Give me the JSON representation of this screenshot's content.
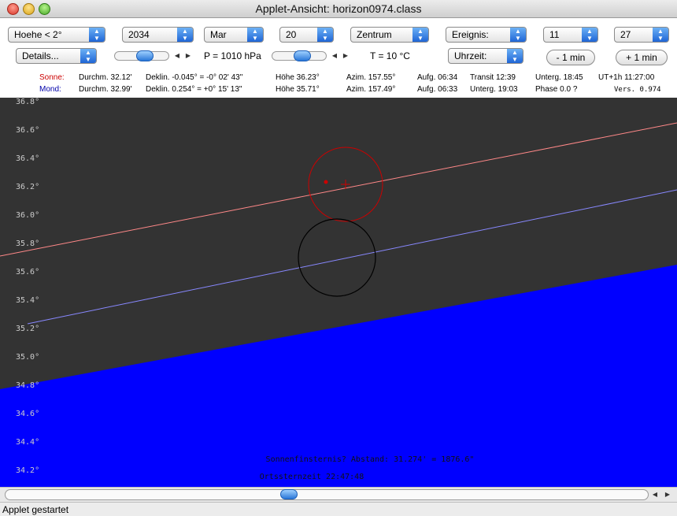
{
  "window": {
    "title": "Applet-Ansicht: horizon0974.class"
  },
  "controls": {
    "height_select": "Hoehe < 2°",
    "year_select": "2034",
    "month_select": "Mar",
    "day_select": "20",
    "center_select": "Zentrum",
    "event_select": "Ereignis:",
    "hour_select": "11",
    "minute_select": "27",
    "details_select": "Details...",
    "pressure_label": "P = 1010 hPa",
    "temp_label": "T = 10 °C",
    "time_select": "Uhrzeit:",
    "minus_min": "- 1 min",
    "plus_min": "+ 1 min"
  },
  "sun": {
    "name": "Sonne:",
    "diameter": "Durchm. 32.12'",
    "declination": "Deklin. -0.045° = -0° 02' 43\"",
    "altitude": "Höhe 36.23°",
    "azimuth": "Azim. 157.55°",
    "rise": "Aufg. 06:34",
    "transit": "Transit 12:39",
    "set": "Unterg. 18:45",
    "ut": "UT+1h  11:27:00"
  },
  "moon": {
    "name": "Mond:",
    "diameter": "Durchm. 32.99'",
    "declination": "Deklin. 0.254° = +0° 15' 13\"",
    "altitude": "Höhe 35.71°",
    "azimuth": "Azim. 157.49°",
    "rise": "Aufg. 06:33",
    "set": "Unterg. 19:03",
    "phase": "Phase 0.0 ?",
    "version": "Vers. 0.974"
  },
  "chart_data": {
    "type": "scatter",
    "y_axis_ticks": [
      "36.8°",
      "36.6°",
      "36.4°",
      "36.2°",
      "36.0°",
      "35.8°",
      "35.6°",
      "35.4°",
      "35.2°",
      "35.0°",
      "34.8°",
      "34.6°",
      "34.4°",
      "34.2°"
    ],
    "sky_color": "#333333",
    "ground_color": "#0000ff",
    "sun_color": "#cc0000",
    "sun_path_color": "#ff8888",
    "moon_path_color": "#8888ff",
    "moon_color": "#000000",
    "eclipse_note": "Sonnenfinsternis? Abstand: 31.274' = 1876.6\"",
    "sidereal_time": "Ortssternzeit 22:47:48"
  },
  "statusbar": {
    "text": "Applet gestartet"
  }
}
